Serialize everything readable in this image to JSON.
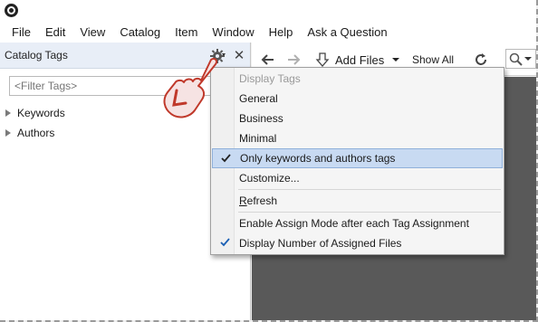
{
  "menu": {
    "items": [
      "File",
      "Edit",
      "View",
      "Catalog",
      "Item",
      "Window",
      "Help",
      "Ask a Question"
    ]
  },
  "left_panel": {
    "title": "Catalog Tags",
    "filter_placeholder": "<Filter Tags>",
    "tree": [
      {
        "label": "Keywords"
      },
      {
        "label": "Authors"
      }
    ]
  },
  "toolbar": {
    "add_files_label": "Add Files",
    "show_all_label": "Show All"
  },
  "dropdown": {
    "header": "Display Tags",
    "items": [
      {
        "label": "General",
        "checked": false
      },
      {
        "label": "Business",
        "checked": false
      },
      {
        "label": "Minimal",
        "checked": false
      },
      {
        "label": "Only keywords and authors tags",
        "checked": true,
        "highlighted": true
      },
      {
        "label": "Customize...",
        "checked": false
      },
      {
        "label_underlined": "R",
        "label_rest": "efresh",
        "checked": false
      },
      {
        "label": "Enable Assign Mode after each Tag Assignment",
        "checked": false
      },
      {
        "label": "Display Number of Assigned Files",
        "checked": true
      }
    ]
  },
  "colors": {
    "panel_header": "#e8eef7",
    "highlight": "#c8daf2",
    "dark_area": "#595959",
    "hand_cursor": "#c0392b"
  },
  "icons": [
    "app-logo-icon",
    "gear-icon",
    "close-icon",
    "back-arrow-icon",
    "forward-arrow-icon",
    "add-files-icon",
    "dropdown-caret-icon",
    "refresh-icon",
    "search-icon",
    "hand-pointer-icon",
    "checkmark-icon"
  ]
}
